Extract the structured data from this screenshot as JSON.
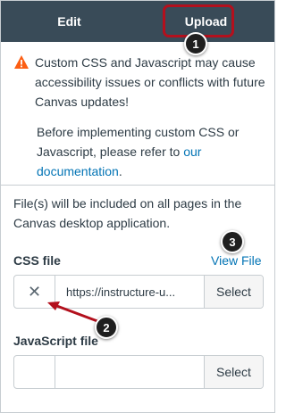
{
  "tabs": [
    {
      "label": "Edit"
    },
    {
      "label": "Upload"
    }
  ],
  "warning": {
    "line1": "Custom CSS and Javascript may cause accessibility issues or conflicts with future Canvas updates!",
    "line2_prefix": "Before implementing custom CSS or Javascript, please refer to ",
    "link": "our documentation",
    "line2_suffix": "."
  },
  "info": "File(s) will be included on all pages in the Canvas desktop application.",
  "css_file": {
    "label": "CSS file",
    "view_link": "View File",
    "clear": "✕",
    "path": "https://instructure-u...",
    "select": "Select"
  },
  "js_file": {
    "label": "JavaScript file",
    "path": "",
    "select": "Select"
  },
  "callouts": [
    "1",
    "2",
    "3"
  ],
  "colors": {
    "tabbar": "#394b58",
    "highlight": "#b3101d",
    "link": "#0374b5",
    "warning": "#fc5e13"
  }
}
